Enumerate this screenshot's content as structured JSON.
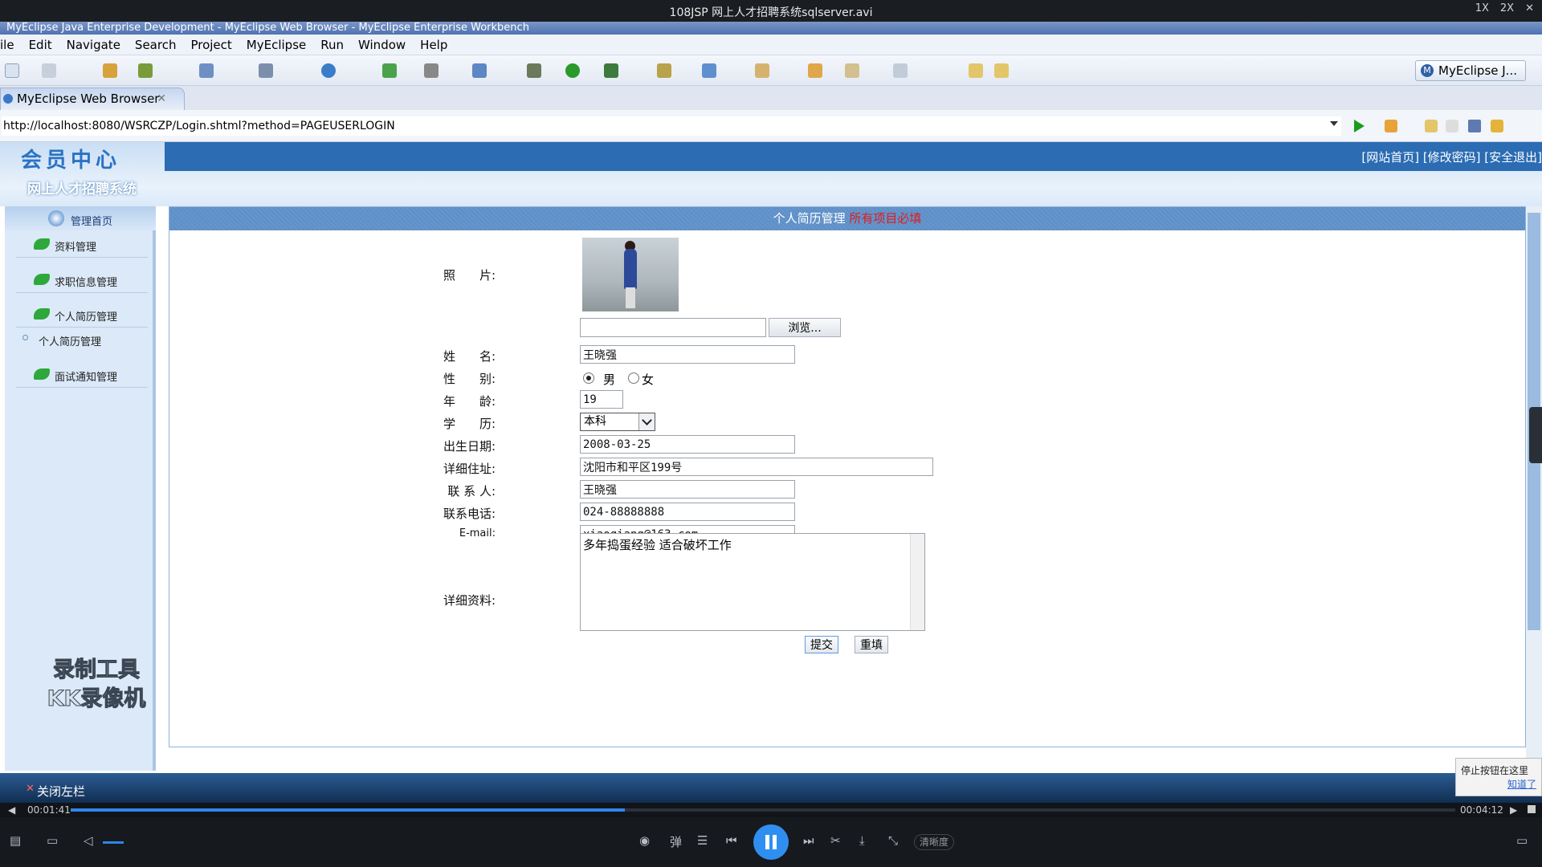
{
  "player": {
    "title": "108JSP 网上人才招聘系统sqlserver.avi",
    "controls": [
      "1X",
      "2X"
    ],
    "time_current": "00:01:41",
    "time_total": "00:04:12",
    "progress": 0.4,
    "quality_label": "清晰度",
    "tip_text": "停止按钮在这里",
    "tip_link": "知道了"
  },
  "eclipse": {
    "window_title": "MyEclipse Java Enterprise Development - MyEclipse Web Browser - MyEclipse Enterprise Workbench",
    "menu": [
      "ile",
      "Edit",
      "Navigate",
      "Search",
      "Project",
      "MyEclipse",
      "Run",
      "Window",
      "Help"
    ],
    "perspective": "MyEclipse J...",
    "tab_title": "MyEclipse Web Browser",
    "url": "http://localhost:8080/WSRCZP/Login.shtml?method=PAGEUSERLOGIN"
  },
  "site": {
    "logo": "会员中心",
    "name": "网上人才招聘系统",
    "top_links": "[网站首页] [修改密码] [安全退出]",
    "nav_home": "管理首页",
    "nav_items": [
      "资料管理",
      "求职信息管理",
      "个人简历管理"
    ],
    "nav_sub": "个人简历管理",
    "nav_last": "面试通知管理",
    "close_left": "关闭左栏",
    "watermark": [
      "录制工具",
      "KK录像机"
    ]
  },
  "form": {
    "header": "个人简历管理",
    "header_note": "所有项目必填",
    "labels": {
      "photo": "照　　片:",
      "name": "姓　　名:",
      "gender": "性　　别:",
      "age": "年　　龄:",
      "education": "学　　历:",
      "birthdate": "出生日期:",
      "address": "详细住址:",
      "contact": "联 系 人:",
      "phone": "联系电话:",
      "email": "E-mail:",
      "details": "详细资料:"
    },
    "browse_label": "浏览...",
    "name": "王晓强",
    "gender_male": "男",
    "gender_female": "女",
    "gender_selected": "男",
    "age": "19",
    "education": "本科",
    "birthdate": "2008-03-25",
    "address": "沈阳市和平区199号",
    "contact": "王晓强",
    "phone": "024-88888888",
    "email": "xiaoqiang@163.com",
    "details": "多年捣蛋经验 适合破坏工作",
    "submit_label": "提交",
    "reset_label": "重填"
  }
}
